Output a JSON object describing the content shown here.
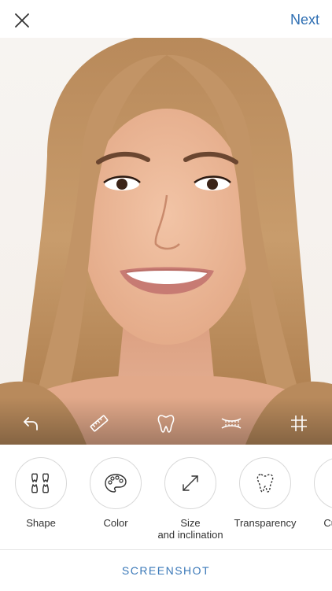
{
  "header": {
    "close_icon": "close-icon",
    "next_label": "Next",
    "accent_color": "#2f6fb3"
  },
  "photo": {
    "subject": "smiling woman portrait",
    "toolbar_icons": [
      "undo-icon",
      "ruler-icon",
      "tooth-icon",
      "teeth-row-icon",
      "grid-icon"
    ]
  },
  "tools": [
    {
      "label": "Shape",
      "icon": "teeth-shape-icon"
    },
    {
      "label": "Color",
      "icon": "palette-icon"
    },
    {
      "label": "Size\nand inclination",
      "icon": "resize-arrows-icon"
    },
    {
      "label": "Transparency",
      "icon": "tooth-dashed-icon"
    },
    {
      "label": "Cutting",
      "icon": "cutting-icon"
    }
  ],
  "bottom": {
    "label": "SCREENSHOT"
  }
}
